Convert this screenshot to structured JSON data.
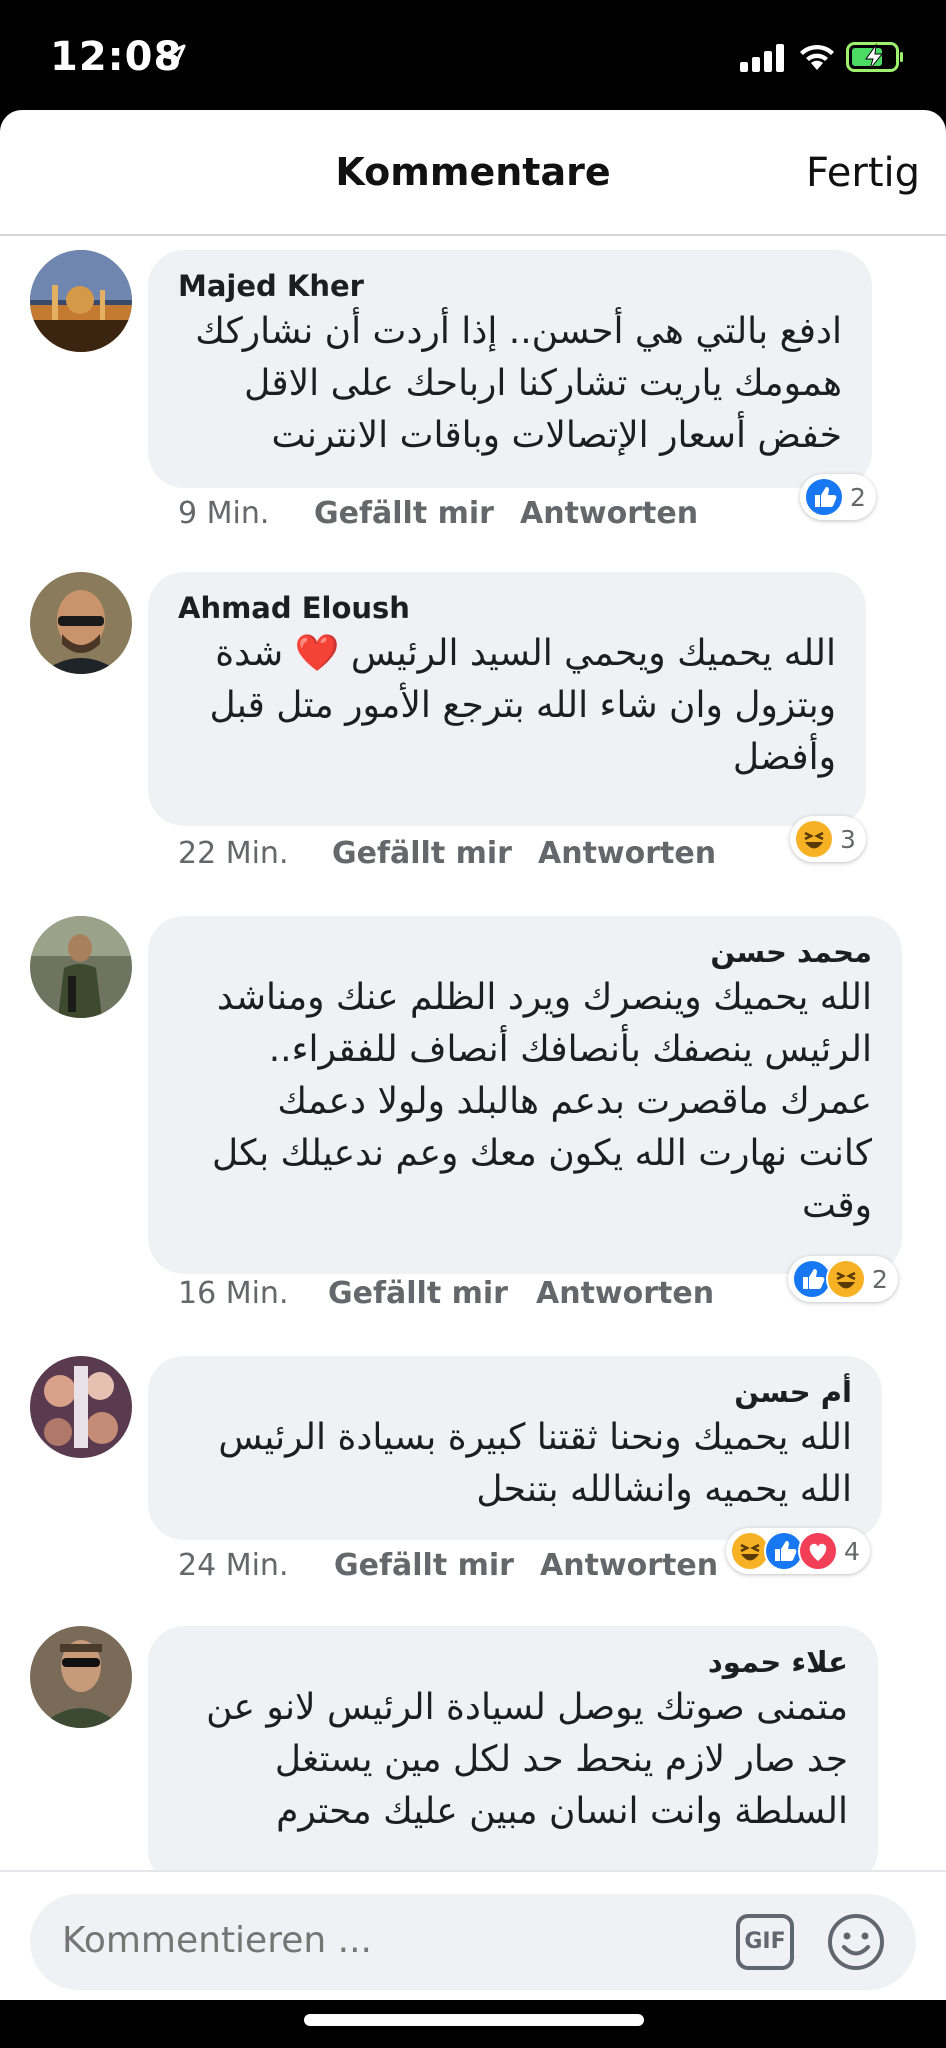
{
  "status_bar": {
    "time": "12:08"
  },
  "header": {
    "title": "Kommentare",
    "done_label": "Fertig"
  },
  "comments": [
    {
      "author": "Majed Kher",
      "lines": [
        "ادفع بالتي هي أحسن.. إذا أردت أن نشاركك",
        "همومك ياريت تشاركنا ارباحك على الاقل",
        "خفض أسعار الإتصالات وباقات الانترنت"
      ],
      "time": "9 Min.",
      "like_label": "Gefällt mir",
      "reply_label": "Antworten",
      "reactions": [
        "like"
      ],
      "reaction_count": "2"
    },
    {
      "author": "Ahmad Eloush",
      "lines": [
        "الله يحميك ويحمي السيد الرئيس ❤️ شدة",
        "وبتزول وان شاء الله بترجع الأمور متل قبل",
        "وأفضل"
      ],
      "time": "22 Min.",
      "like_label": "Gefällt mir",
      "reply_label": "Antworten",
      "reactions": [
        "haha"
      ],
      "reaction_count": "3"
    },
    {
      "author": "محمد حسن",
      "lines": [
        "الله يحميك وينصرك ويرد الظلم عنك ومناشد",
        "الرئيس ينصفك  بأنصافك أنصاف للفقراء..",
        "عمرك ماقصرت بدعم هالبلد ولولا دعمك",
        "كانت نهارت الله يكون معك وعم ندعيلك بكل",
        "وقت"
      ],
      "time": "16 Min.",
      "like_label": "Gefällt mir",
      "reply_label": "Antworten",
      "reactions": [
        "like",
        "haha"
      ],
      "reaction_count": "2"
    },
    {
      "author": "أم حسن",
      "lines": [
        "الله يحميك ونحنا ثقتنا كبيرة بسيادة الرئيس",
        "الله يحميه  وانشالله بتنحل"
      ],
      "time": "24 Min.",
      "like_label": "Gefällt mir",
      "reply_label": "Antworten",
      "reactions": [
        "haha",
        "like",
        "love"
      ],
      "reaction_count": "4"
    },
    {
      "author": "علاء حمود",
      "lines": [
        "متمنى صوتك يوصل لسيادة الرئيس لانو عن",
        "جد صار لازم ينحط حد لكل مين يستغل",
        "السلطة وانت انسان مبين عليك محترم"
      ],
      "time": "",
      "like_label": "",
      "reply_label": "",
      "reactions": [],
      "reaction_count": ""
    }
  ],
  "composer": {
    "placeholder": "Kommentieren ...",
    "gif_label": "GIF"
  },
  "colors": {
    "like_blue": "#1877f2",
    "love_red": "#f33e58",
    "haha_yellow": "#f7b125",
    "bubble": "#f0f1f4"
  }
}
